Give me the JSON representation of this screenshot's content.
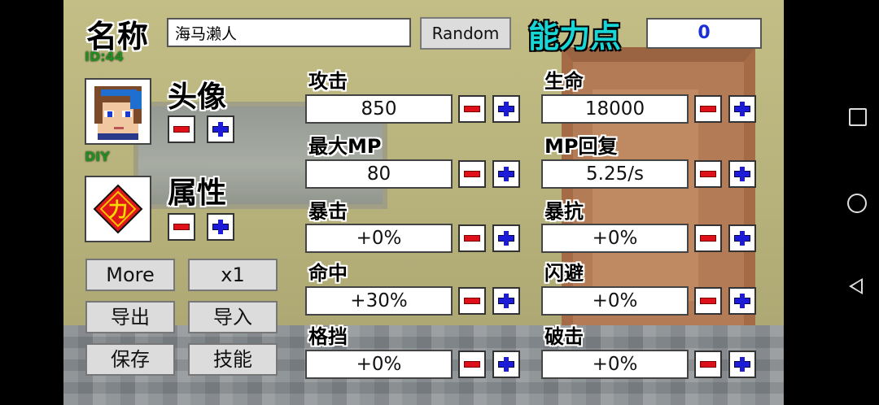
{
  "header": {
    "name_label": "名称",
    "id_label": "ID:44",
    "name_value": "海马濑人",
    "random_label": "Random",
    "ability_points_label": "能力点",
    "ability_points_value": "0"
  },
  "left": {
    "avatar_label": "头像",
    "diy_label": "DIY",
    "attribute_label": "属性",
    "attribute_icon_char": "力",
    "buttons": {
      "more": "More",
      "x1": "x1",
      "export": "导出",
      "import": "导入",
      "save": "保存",
      "skills": "技能"
    }
  },
  "stats": [
    {
      "label": "攻击",
      "value": "850"
    },
    {
      "label": "生命",
      "value": "18000"
    },
    {
      "label": "最大MP",
      "value": "80"
    },
    {
      "label": "MP回复",
      "value": "5.25/s"
    },
    {
      "label": "暴击",
      "value": "+0%"
    },
    {
      "label": "暴抗",
      "value": "+0%"
    },
    {
      "label": "命中",
      "value": "+30%"
    },
    {
      "label": "闪避",
      "value": "+0%"
    },
    {
      "label": "格挡",
      "value": "+0%"
    },
    {
      "label": "破击",
      "value": "+0%"
    }
  ],
  "colors": {
    "ability_points": "#19d6d6",
    "id_text": "#1f8f1f",
    "minus": "#e0101a",
    "plus": "#1b1bd8"
  }
}
